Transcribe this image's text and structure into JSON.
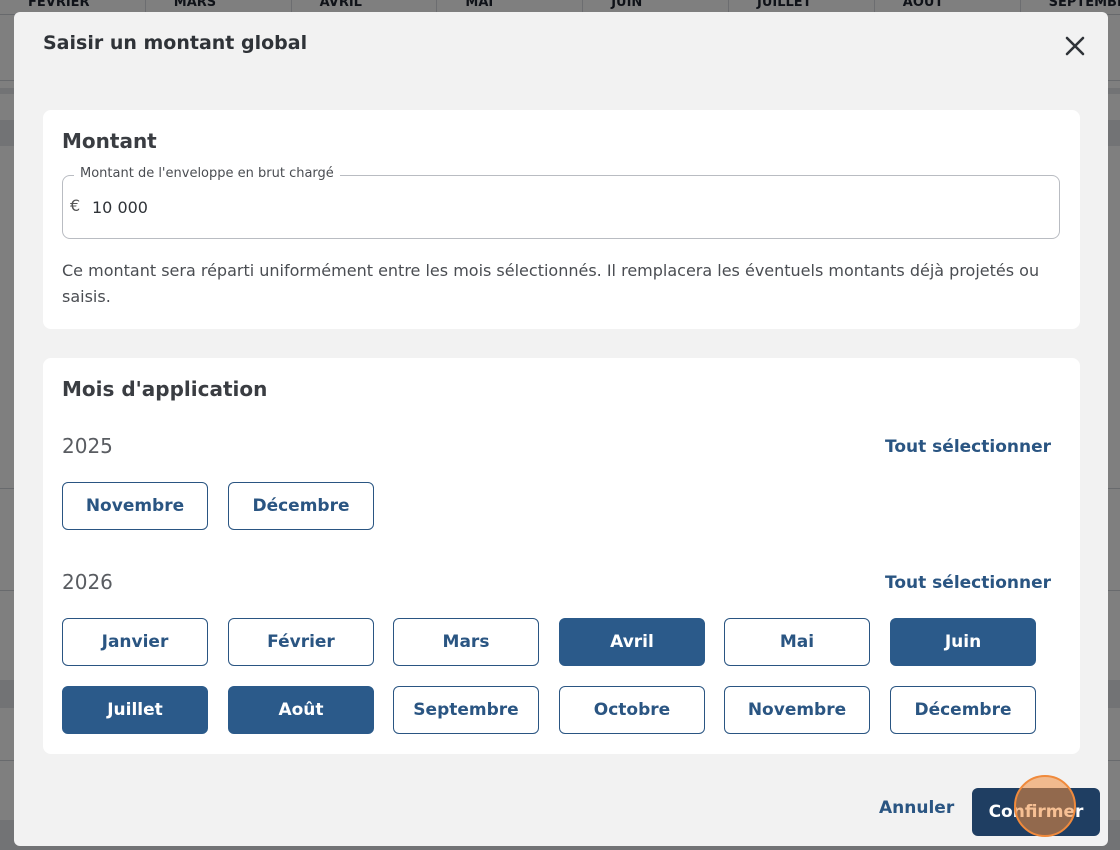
{
  "background": {
    "months_header": [
      "FÉVRIER",
      "MARS",
      "AVRIL",
      "MAI",
      "JUIN",
      "JUILLET",
      "AOÛT",
      "SEPTEMBRE"
    ]
  },
  "modal": {
    "title": "Saisir un montant global",
    "close_icon": "close-icon",
    "amount_section": {
      "title": "Montant",
      "field_label": "Montant de l'enveloppe en brut chargé",
      "currency_symbol": "€",
      "value": "10 000",
      "help_text": "Ce montant sera réparti uniformément entre les mois sélectionnés. Il remplacera les éventuels montants déjà projetés ou saisis."
    },
    "months_section": {
      "title": "Mois d'application",
      "years": [
        {
          "year": "2025",
          "select_all": "Tout sélectionner",
          "months": [
            {
              "label": "Novembre",
              "selected": false
            },
            {
              "label": "Décembre",
              "selected": false
            }
          ]
        },
        {
          "year": "2026",
          "select_all": "Tout sélectionner",
          "months": [
            {
              "label": "Janvier",
              "selected": false
            },
            {
              "label": "Février",
              "selected": false
            },
            {
              "label": "Mars",
              "selected": false
            },
            {
              "label": "Avril",
              "selected": true
            },
            {
              "label": "Mai",
              "selected": false
            },
            {
              "label": "Juin",
              "selected": true
            },
            {
              "label": "Juillet",
              "selected": true
            },
            {
              "label": "Août",
              "selected": true
            },
            {
              "label": "Septembre",
              "selected": false
            },
            {
              "label": "Octobre",
              "selected": false
            },
            {
              "label": "Novembre",
              "selected": false
            },
            {
              "label": "Décembre",
              "selected": false
            }
          ]
        }
      ]
    },
    "footer": {
      "cancel_label": "Annuler",
      "confirm_label": "Confirmer"
    }
  },
  "colors": {
    "primary": "#2a5582",
    "selected_fill": "#2b5a8a",
    "confirm_fill": "#1f3e62",
    "click_marker": "#f08a3c"
  }
}
